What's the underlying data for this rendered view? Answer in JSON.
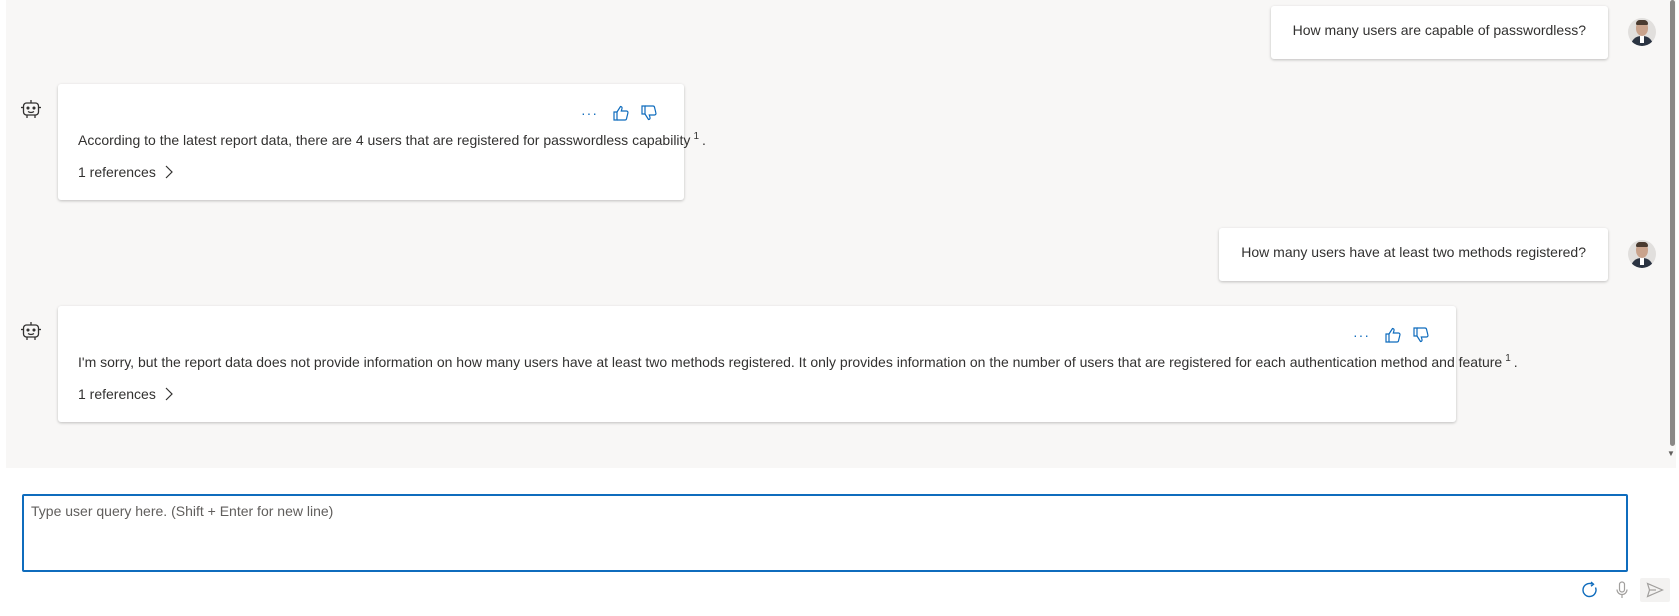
{
  "conversation": {
    "messages": [
      {
        "role": "user",
        "text": "How many users are capable of passwordless?"
      },
      {
        "role": "assistant",
        "text": "According to the latest report data, there are 4 users that are registered for passwordless capability",
        "citation": "1",
        "end": ".",
        "references_label": "1 references"
      },
      {
        "role": "user",
        "text": "How many users have at least two methods registered?"
      },
      {
        "role": "assistant",
        "text": "I'm sorry, but the report data does not provide information on how many users have at least two methods registered. It only provides information on the number of users that are registered for each authentication method and feature",
        "citation": "1",
        "end": ".",
        "references_label": "1 references"
      }
    ],
    "actions": {
      "more": "···"
    }
  },
  "composer": {
    "placeholder": "Type user query here. (Shift + Enter for new line)",
    "value": ""
  },
  "icons": {
    "bot": "bot-icon",
    "more": "more-options-icon",
    "like": "thumbs-up-icon",
    "dislike": "thumbs-down-icon",
    "refs": "chevron-right-icon",
    "reset": "refresh-icon",
    "mic": "microphone-icon",
    "send": "send-icon"
  },
  "colors": {
    "accent": "#0f6cbd",
    "chat_background": "#f8f7f6",
    "bubble": "#ffffff"
  }
}
